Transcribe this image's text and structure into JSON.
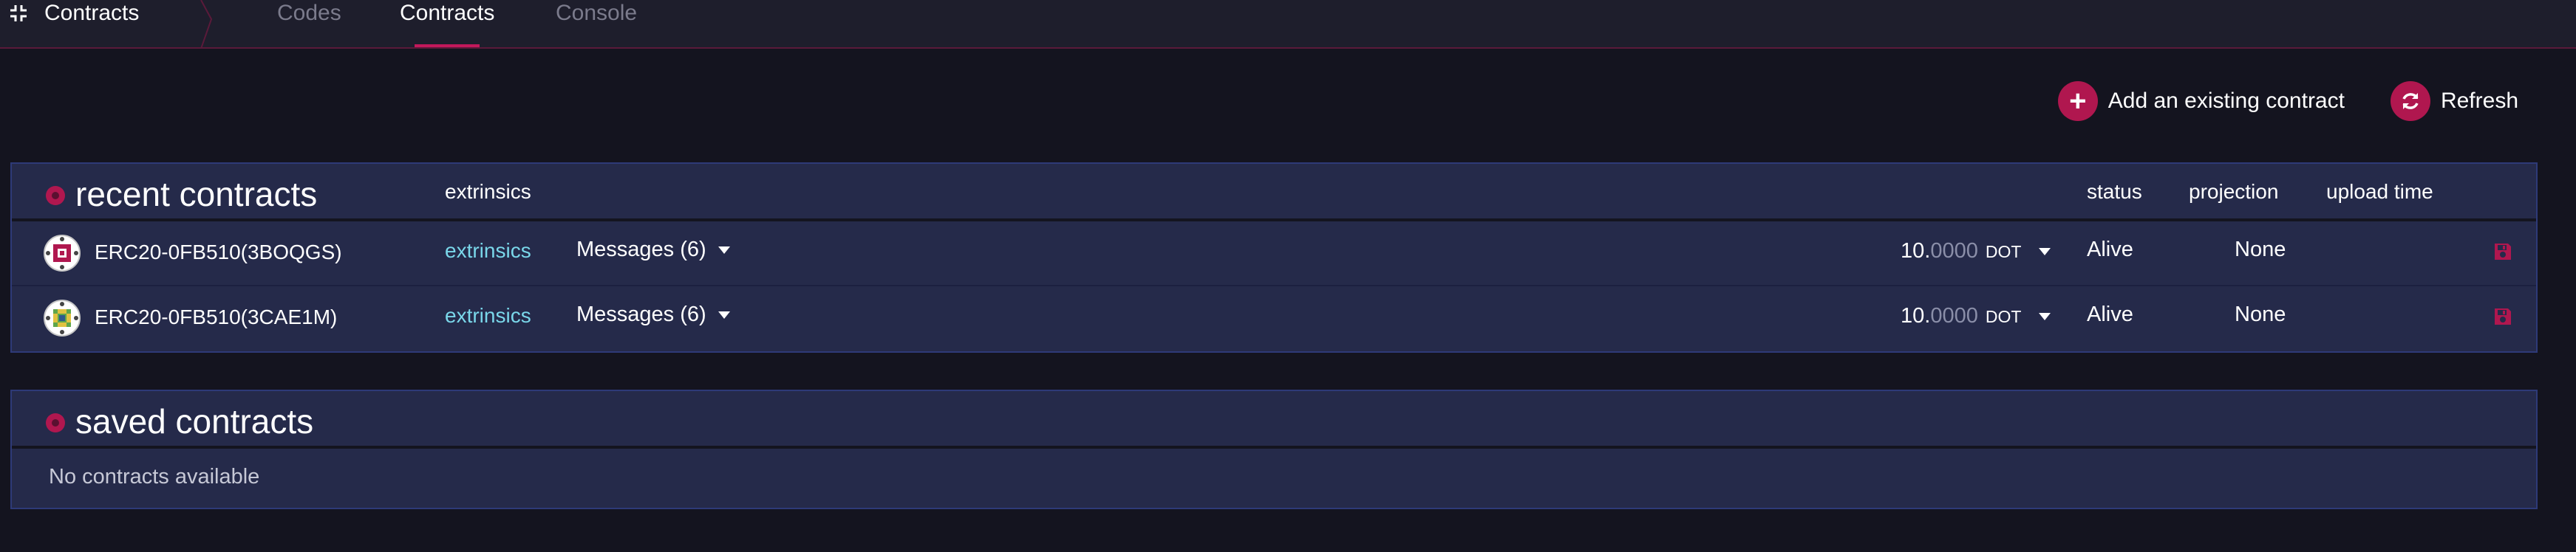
{
  "header": {
    "app_title": "Contracts",
    "tabs": [
      {
        "label": "Codes",
        "active": false
      },
      {
        "label": "Contracts",
        "active": true
      },
      {
        "label": "Console",
        "active": false
      }
    ]
  },
  "actions": {
    "add_existing": "Add an existing contract",
    "refresh": "Refresh"
  },
  "recent": {
    "title": "recent contracts",
    "columns": {
      "extrinsics": "extrinsics",
      "status": "status",
      "projection": "projection",
      "upload_time": "upload time"
    },
    "rows": [
      {
        "name": "ERC20-0FB510(3BOQGS)",
        "extrinsics": "extrinsics",
        "messages": "Messages (6)",
        "balance_int": "10.",
        "balance_frac": "0000",
        "unit": "DOT",
        "status": "Alive",
        "projection": "None",
        "upload_time": ""
      },
      {
        "name": "ERC20-0FB510(3CAE1M)",
        "extrinsics": "extrinsics",
        "messages": "Messages (6)",
        "balance_int": "10.",
        "balance_frac": "0000",
        "unit": "DOT",
        "status": "Alive",
        "projection": "None",
        "upload_time": ""
      }
    ]
  },
  "saved": {
    "title": "saved contracts",
    "empty_text": "No contracts available"
  },
  "colors": {
    "accent": "#b0174f",
    "link": "#7ad7ea",
    "card_bg": "#252a4a",
    "page_bg": "#14141f"
  },
  "icons": {
    "collapse": "collapse-icon",
    "add": "plus-circle-icon",
    "refresh": "refresh-icon",
    "save": "save-icon"
  }
}
